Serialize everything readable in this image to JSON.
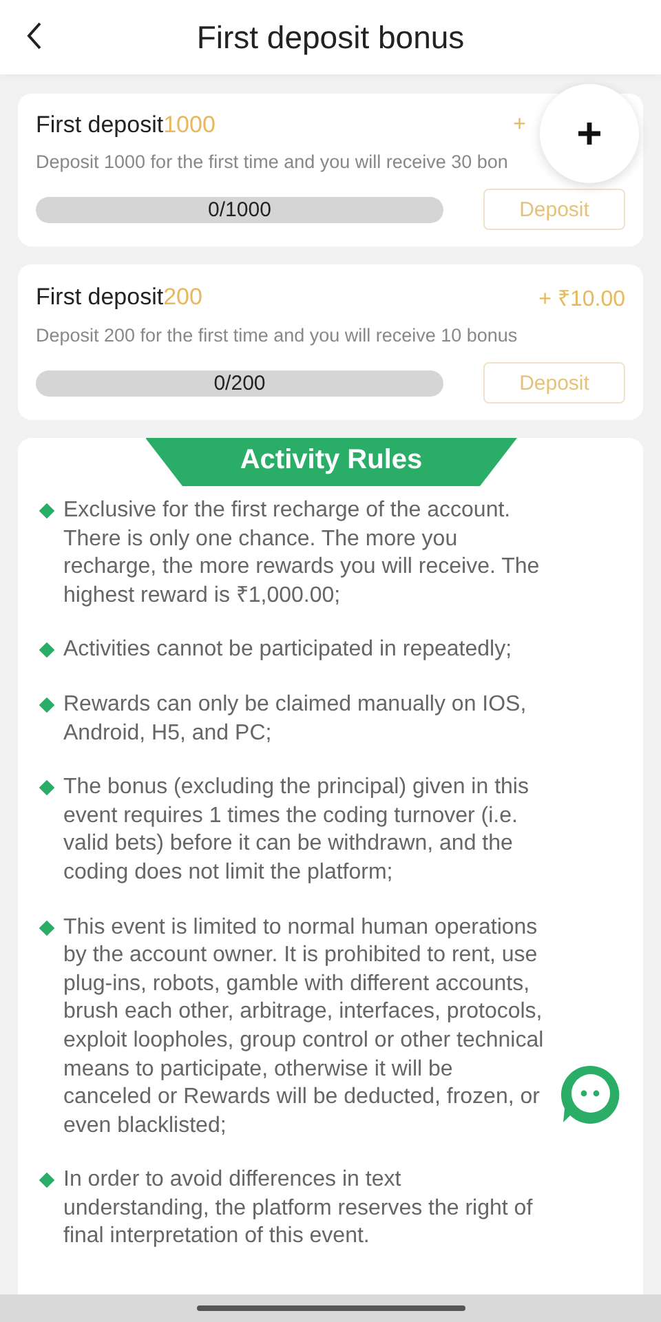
{
  "header": {
    "title": "First deposit bonus"
  },
  "bonuses": [
    {
      "label": "First deposit",
      "amount": "1000",
      "reward": "+",
      "description": "Deposit 1000 for the first time and you will receive 30 bon",
      "progress": "0/1000",
      "level": 0,
      "button": "Deposit"
    },
    {
      "label": "First deposit",
      "amount": "200",
      "reward": "+ ₹10.00",
      "description": "Deposit 200 for the first time and you will receive 10 bonus",
      "progress": "0/200",
      "level": 0,
      "button": "Deposit"
    }
  ],
  "rules": {
    "title": "Activity Rules",
    "items": [
      "Exclusive for the first recharge of the account. There is only one chance. The more you recharge, the more rewards you will receive. The highest reward is ₹1,000.00;",
      "Activities cannot be participated in repeatedly;",
      "Rewards can only be claimed manually on IOS, Android, H5, and PC;",
      "The bonus (excluding the principal) given in this event requires 1 times the coding turnover (i.e. valid bets) before it can be withdrawn, and the coding does not limit the platform;",
      "This event is limited to normal human operations by the account owner. It is prohibited to rent, use plug-ins, robots, gamble with different accounts, brush each other, arbitrage, interfaces, protocols, exploit loopholes, group control or other technical means to participate, otherwise it will be canceled or Rewards will be deducted, frozen, or even blacklisted;",
      "In order to avoid differences in text understanding, the platform reserves the right of final interpretation of this event."
    ]
  }
}
